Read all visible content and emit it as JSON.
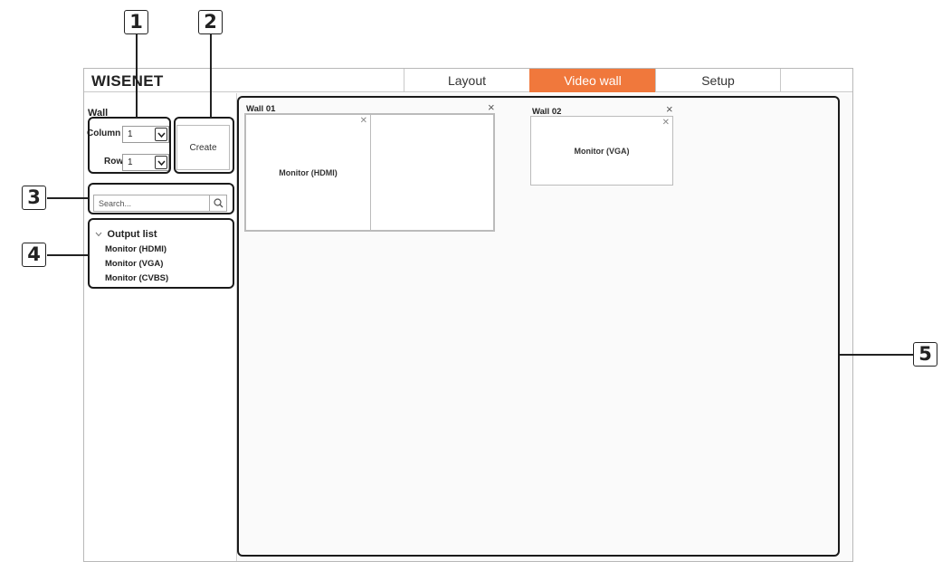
{
  "callouts": [
    "1",
    "2",
    "3",
    "4",
    "5"
  ],
  "app": {
    "logo": "WISENET",
    "tabs": [
      {
        "label": "Layout",
        "active": false
      },
      {
        "label": "Video wall",
        "active": true
      },
      {
        "label": "Setup",
        "active": false
      }
    ],
    "accent_color": "#f0783c"
  },
  "sidebar": {
    "section_title": "Wall",
    "column_label": "Column",
    "column_value": "1",
    "row_label": "Row",
    "row_value": "1",
    "create_label": "Create",
    "search_placeholder": "Search...",
    "output_list_title": "Output list",
    "outputs": [
      "Monitor (HDMI)",
      "Monitor (VGA)",
      "Monitor (CVBS)"
    ]
  },
  "walls": [
    {
      "title": "Wall 01",
      "close": "×",
      "cells": [
        {
          "label": "Monitor (HDMI)"
        },
        {
          "label": ""
        }
      ]
    },
    {
      "title": "Wall 02",
      "close": "×",
      "cells": [
        {
          "label": "Monitor (VGA)"
        }
      ]
    }
  ]
}
